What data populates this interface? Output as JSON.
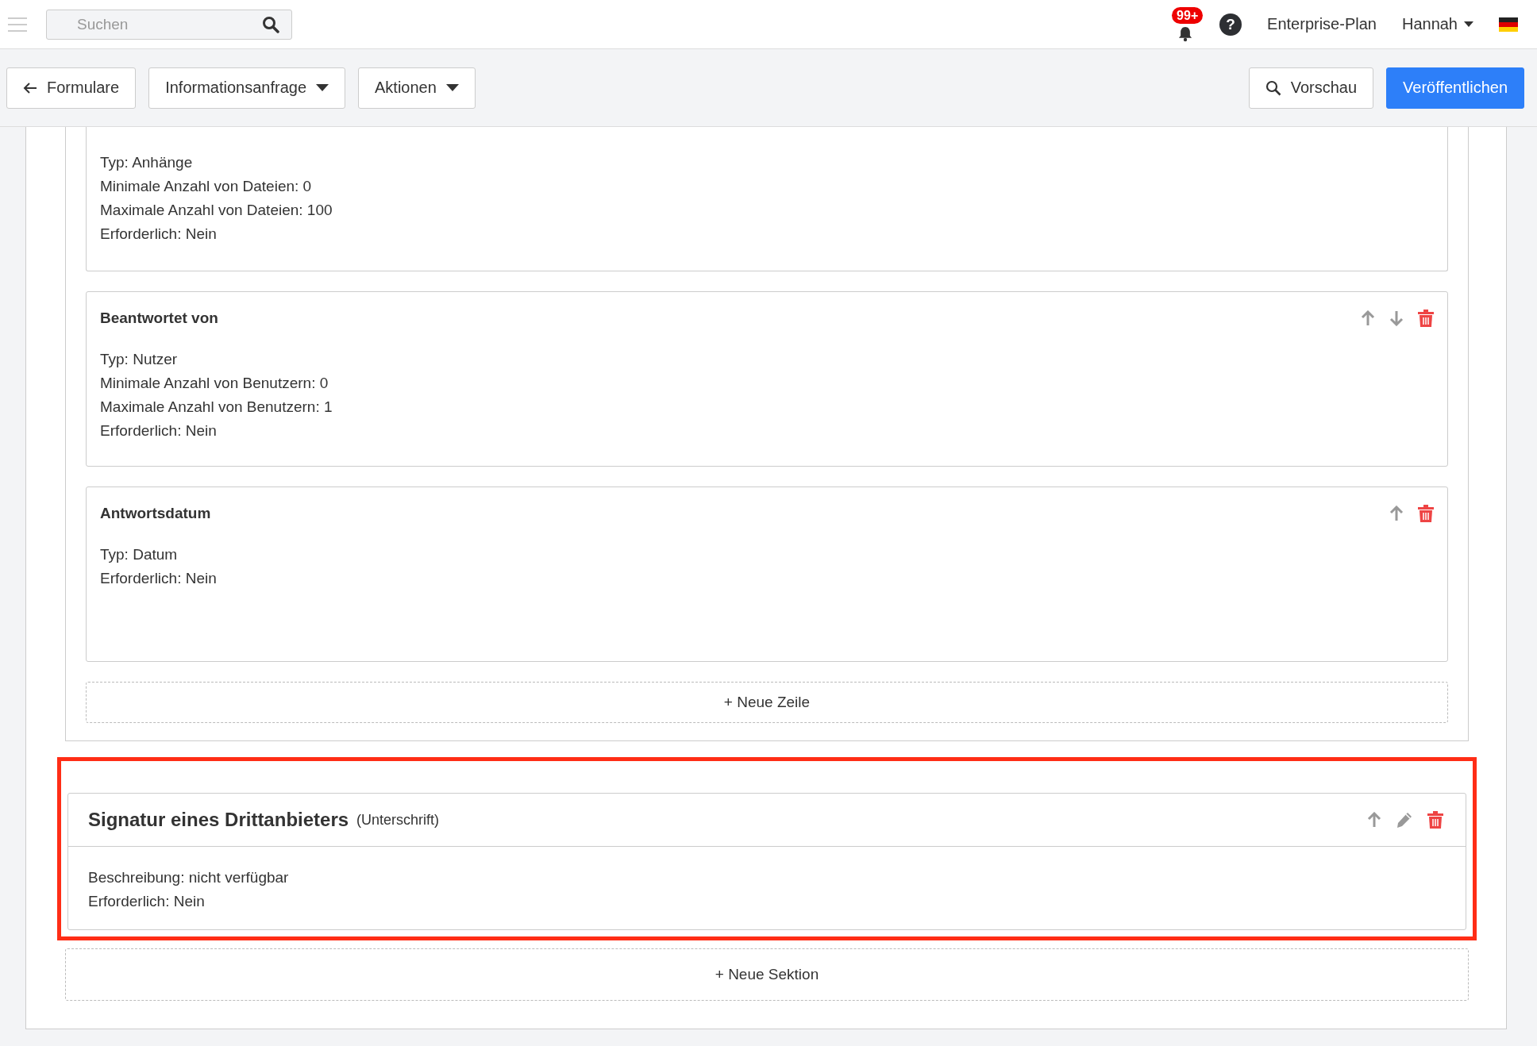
{
  "topbar": {
    "search": {
      "placeholder": "Suchen"
    },
    "notifications_badge": "99+",
    "help": "?",
    "plan": "Enterprise-Plan",
    "user": "Hannah"
  },
  "toolbar": {
    "back": "Formulare",
    "form_menu": "Informationsanfrage",
    "actions_menu": "Aktionen",
    "preview": "Vorschau",
    "publish": "Veröffentlichen"
  },
  "fields": [
    {
      "lines": [
        "Typ: Anhänge",
        "Minimale Anzahl von Dateien: 0",
        "Maximale Anzahl von Dateien: 100",
        "Erforderlich: Nein"
      ]
    },
    {
      "title": "Beantwortet von",
      "lines": [
        "Typ: Nutzer",
        "Minimale Anzahl von Benutzern: 0",
        "Maximale Anzahl von Benutzern: 1",
        "Erforderlich: Nein"
      ],
      "can_move_up": true,
      "can_move_down": true
    },
    {
      "title": "Antwortsdatum",
      "lines": [
        "Typ: Datum",
        "Erforderlich: Nein"
      ],
      "can_move_up": true,
      "can_move_down": false
    }
  ],
  "new_row": "+ Neue Zeile",
  "section": {
    "title": "Signatur eines Drittanbieters",
    "type": "(Unterschrift)",
    "lines": [
      "Beschreibung: nicht verfügbar",
      "Erforderlich: Nein"
    ],
    "highlighted": true
  },
  "new_section": "+ Neue Sektion"
}
